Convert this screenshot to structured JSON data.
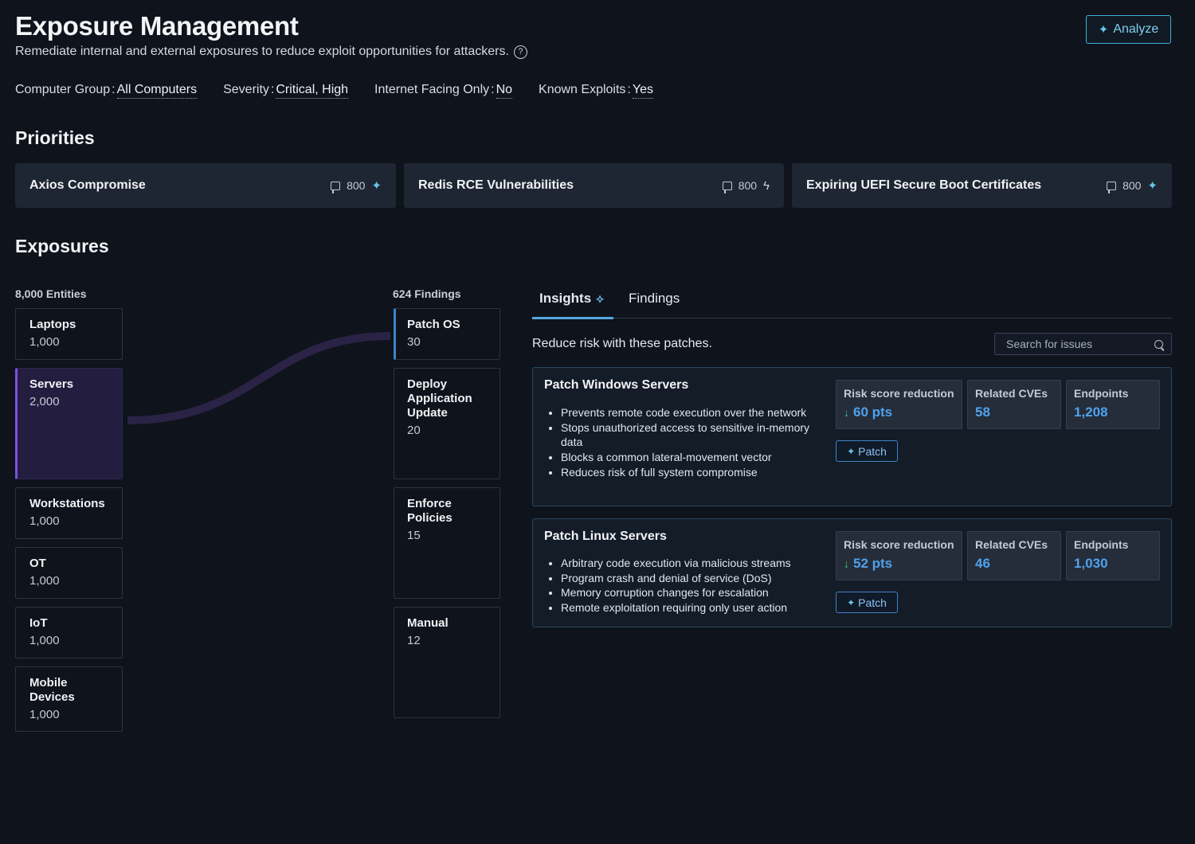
{
  "header": {
    "title": "Exposure Management",
    "subtitle": "Remediate internal and external exposures to reduce exploit opportunities for attackers.",
    "help_icon": "?",
    "analyze_label": "Analyze"
  },
  "filters": [
    {
      "label": "Computer Group",
      "value": "All Computers"
    },
    {
      "label": "Severity",
      "value": "Critical, High"
    },
    {
      "label": "Internet Facing Only",
      "value": "No"
    },
    {
      "label": "Known Exploits",
      "value": "Yes"
    }
  ],
  "priorities": {
    "heading": "Priorities",
    "items": [
      {
        "title": "Axios Compromise",
        "count": "800",
        "icon": "sparkle-icon"
      },
      {
        "title": "Redis RCE Vulnerabilities",
        "count": "800",
        "icon": "bolt-icon"
      },
      {
        "title": "Expiring UEFI Secure Boot Certificates",
        "count": "800",
        "icon": "sparkle-icon"
      }
    ]
  },
  "exposures": {
    "heading": "Exposures",
    "entities_header": "8,000 Entities",
    "findings_header": "624 Findings",
    "entities": [
      {
        "name": "Laptops",
        "count": "1,000"
      },
      {
        "name": "Servers",
        "count": "2,000",
        "selected": true
      },
      {
        "name": "Workstations",
        "count": "1,000"
      },
      {
        "name": "OT",
        "count": "1,000"
      },
      {
        "name": "IoT",
        "count": "1,000"
      },
      {
        "name": "Mobile Devices",
        "count": "1,000"
      }
    ],
    "findings": [
      {
        "name": "Patch OS",
        "count": "30",
        "selected": true
      },
      {
        "name": "Deploy Application Update",
        "count": "20"
      },
      {
        "name": "Enforce Policies",
        "count": "15"
      },
      {
        "name": "Manual",
        "count": "12"
      }
    ],
    "flow_color": "#2a2346"
  },
  "insights": {
    "tabs": [
      {
        "label": "Insights",
        "active": true
      },
      {
        "label": "Findings",
        "active": false
      }
    ],
    "intro": "Reduce risk with these patches.",
    "search_placeholder": "Search for issues",
    "cards": [
      {
        "title": "Patch Windows Servers",
        "bullets": [
          "Prevents remote code execution over the network",
          "Stops unauthorized access to sensitive in-memory data",
          "Blocks a common lateral-movement vector",
          "Reduces risk of full system compromise"
        ],
        "stats": {
          "risk_label": "Risk score reduction",
          "risk_value": "60 pts",
          "cves_label": "Related CVEs",
          "cves_value": "58",
          "endpoints_label": "Endpoints",
          "endpoints_value": "1,208"
        },
        "patch_label": "Patch"
      },
      {
        "title": "Patch Linux Servers",
        "bullets": [
          "Arbitrary code execution via malicious streams",
          "Program crash and denial of service (DoS)",
          "Memory corruption changes for escalation",
          "Remote exploitation requiring only user action"
        ],
        "stats": {
          "risk_label": "Risk score reduction",
          "risk_value": "52 pts",
          "cves_label": "Related CVEs",
          "cves_value": "46",
          "endpoints_label": "Endpoints",
          "endpoints_value": "1,030"
        },
        "patch_label": "Patch"
      }
    ]
  },
  "colors": {
    "background": "#0f131b",
    "accent_blue": "#4fa2ec",
    "selected_entity": "#7a52e0",
    "positive_green": "#43c27a"
  }
}
